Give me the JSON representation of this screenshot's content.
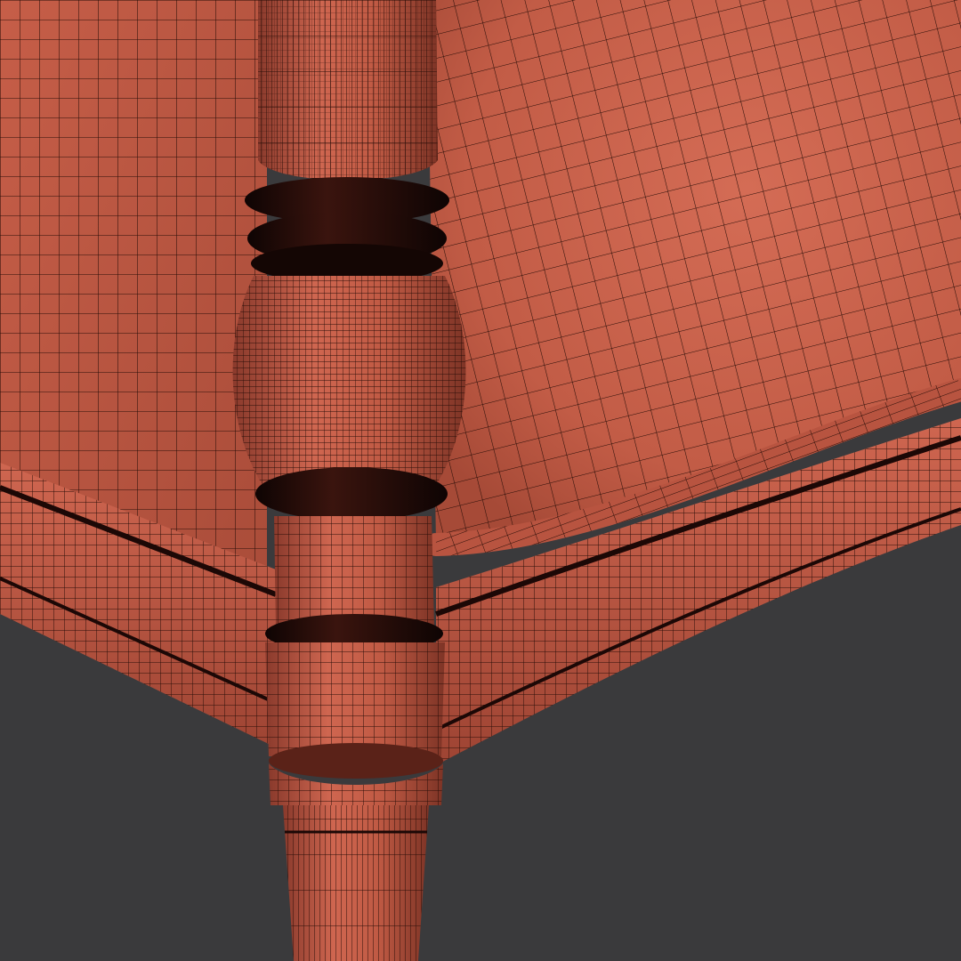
{
  "scene": {
    "subject": "chair-corner-wireframe-render",
    "colors": {
      "background": "#3a3a3c",
      "surface": "#c05a44",
      "surface_light": "#d06a52",
      "surface_shadow": "#8a3a2c",
      "wire": "#2a0e08",
      "ring_dark": "#1c0806"
    }
  }
}
